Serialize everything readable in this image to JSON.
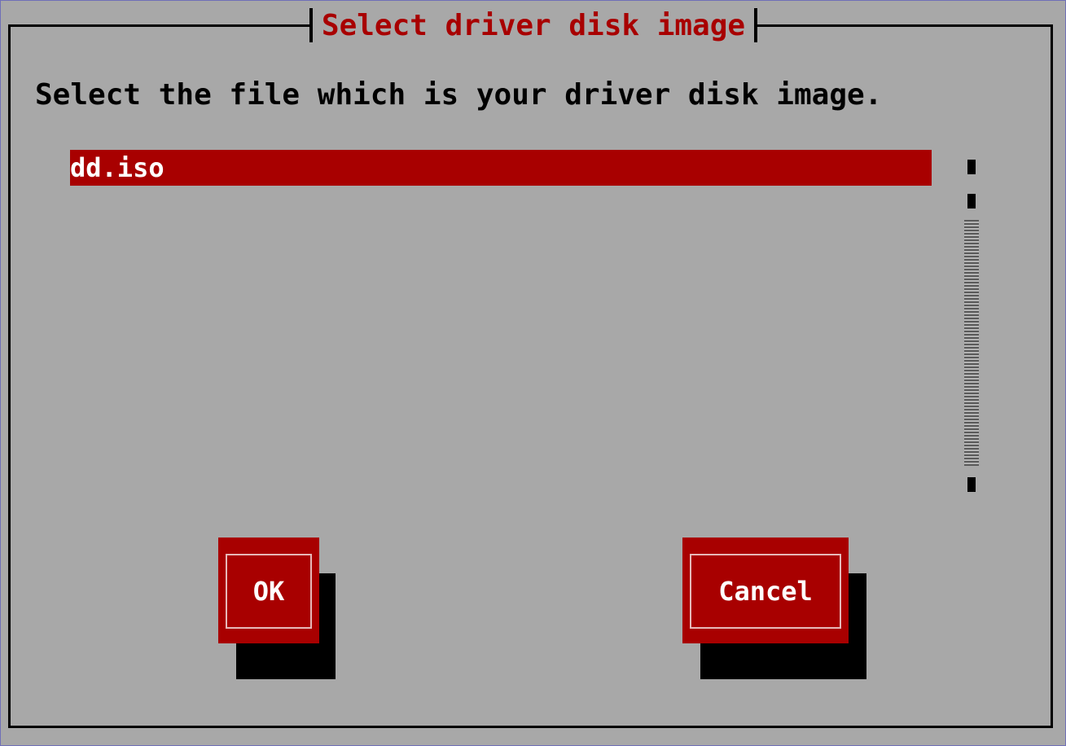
{
  "dialog": {
    "title": "Select driver disk image",
    "prompt": "Select the file which is your driver disk image."
  },
  "file_list": {
    "items": [
      {
        "label": "dd.iso",
        "selected": true
      }
    ]
  },
  "buttons": {
    "ok_label": "OK",
    "cancel_label": "Cancel"
  },
  "colors": {
    "background": "#a8a8a8",
    "accent_red": "#a80000",
    "text_dark": "#000000",
    "text_light": "#ffffff"
  },
  "icons": {
    "scroll_up": "scroll-up-arrow-icon",
    "scroll_down": "scroll-down-arrow-icon"
  }
}
